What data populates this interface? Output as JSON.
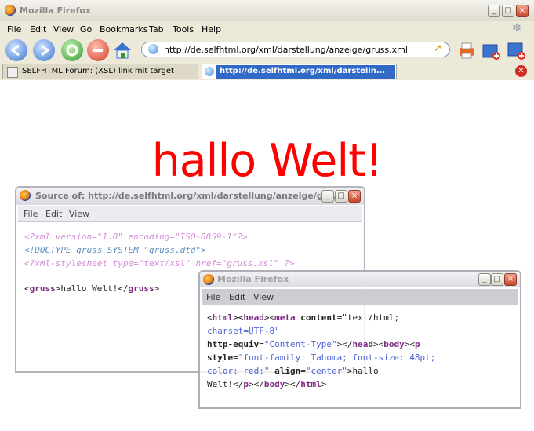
{
  "window": {
    "title": "Mozilla Firefox",
    "controls": {
      "minimize": "_",
      "maximize": "□",
      "close": "×"
    }
  },
  "menu": [
    "File",
    "Edit",
    "View",
    "Go",
    "Bookmarks",
    "Tab",
    "Tools",
    "Help"
  ],
  "toolbar": {
    "icons": [
      "back-icon",
      "forward-icon",
      "reload-icon",
      "stop-icon",
      "home-icon"
    ],
    "url": "http://de.selfhtml.org/xml/darstellung/anzeige/gruss.xml",
    "right_icons": [
      "print-icon",
      "new-tab-icon",
      "bookmark-add-icon"
    ]
  },
  "tabs": [
    {
      "label": "SELFHTML Forum: (XSL) link mit target",
      "active": false
    },
    {
      "label": "http://de.selfhtml.org/xml/darstelln...",
      "active": true
    }
  ],
  "page": {
    "text": "hallo Welt!",
    "color": "#ff0000"
  },
  "source_window": {
    "title": "Source of: http://de.selfhtml.org/xml/darstellung/anzeige/gru...",
    "menu": [
      "File",
      "Edit",
      "View"
    ],
    "lines": {
      "l1": "<?xml version=\"1.0\" encoding=\"ISO-8859-1\"?>",
      "l2": "<!DOCTYPE gruss SYSTEM \"gruss.dtd\">",
      "l3": "<?xml-stylesheet type=\"text/xsl\" href=\"gruss.xsl\" ?>",
      "l5_open": "<",
      "l5_tag": "gruss",
      "l5_mid": ">hallo Welt!</",
      "l5_tag2": "gruss",
      "l5_close": ">"
    }
  },
  "result_window": {
    "title": "Mozilla Firefox",
    "menu": [
      "File",
      "Edit",
      "View"
    ],
    "code": {
      "p1a": "<",
      "t_html": "html",
      "p1b": "><",
      "t_head": "head",
      "p1c": "><",
      "t_meta": "meta",
      "a_content": " content",
      "eq1": "=\"",
      "v_content_a": "text/html;",
      "v_content_b": "charset=UTF-8\"",
      "a_httpequiv": "http-equiv",
      "eq2": "=",
      "v_httpequiv": "\"Content-Type\"",
      "p2a": "></",
      "t_head2": "head",
      "p2b": "><",
      "t_body": "body",
      "p2c": "><",
      "t_p": "p",
      "a_style": "style",
      "eq3": "=",
      "v_style_a": "\"font-family: Tahoma; font-size: 48pt;",
      "v_style_b": "color: red;\"",
      "a_align": " align",
      "eq4": "=",
      "v_align": "\"center\"",
      "p3a": ">hallo",
      "p4a": "Welt!</",
      "t_p2": "p",
      "p4b": "></",
      "t_body2": "body",
      "p4c": "></",
      "t_html2": "html",
      "p4d": ">"
    }
  }
}
